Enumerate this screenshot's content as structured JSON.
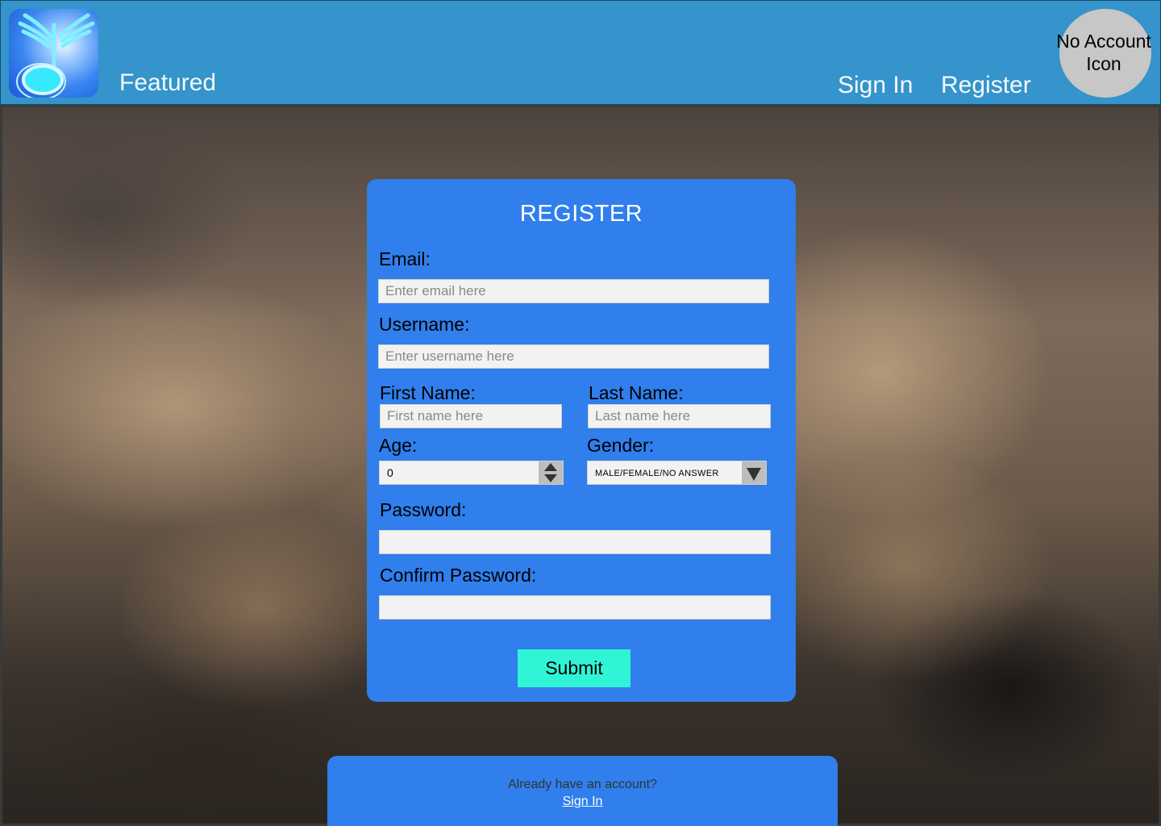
{
  "header": {
    "logo_icon": "music-note-wings-icon",
    "featured_label": "Featured",
    "signin_label": "Sign In",
    "register_label": "Register",
    "account_icon_text": "No Account Icon",
    "background_color": "#3494cb"
  },
  "form": {
    "title": "REGISTER",
    "email_label": "Email:",
    "email_placeholder": "Enter email here",
    "username_label": "Username:",
    "username_placeholder": "Enter username here",
    "first_name_label": "First Name:",
    "first_name_placeholder": "First name here",
    "last_name_label": "Last Name:",
    "last_name_placeholder": "Last name here",
    "age_label": "Age:",
    "age_value": "0",
    "gender_label": "Gender:",
    "gender_value": "MALE/FEMALE/NO ANSWER",
    "password_label": "Password:",
    "confirm_password_label": "Confirm Password:",
    "submit_label": "Submit",
    "card_color": "#307fec",
    "submit_color": "#2ff5d6"
  },
  "footer": {
    "question": "Already have an account?",
    "signin_link": "Sign In"
  }
}
